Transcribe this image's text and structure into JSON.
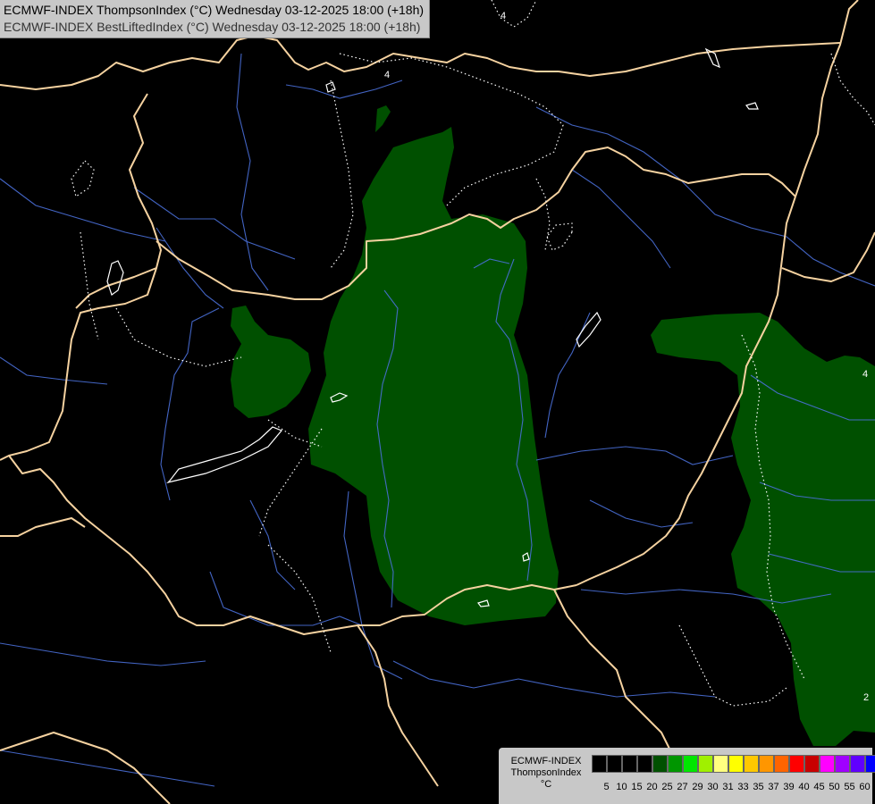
{
  "header": {
    "line1": "ECMWF-INDEX ThompsonIndex (°C) Wednesday 03-12-2025 18:00 (+18h)",
    "line2": "ECMWF-INDEX BestLiftedIndex (°C) Wednesday 03-12-2025 18:00 (+18h)"
  },
  "legend": {
    "source": "ECMWF-INDEX",
    "parameter": "ThompsonIndex",
    "unit": "°C",
    "values": [
      "5",
      "10",
      "15",
      "20",
      "25",
      "27",
      "29",
      "30",
      "31",
      "33",
      "35",
      "37",
      "39",
      "40",
      "45",
      "50",
      "55",
      "60"
    ],
    "colors": [
      "#000000",
      "#000000",
      "#000000",
      "#000000",
      "#005000",
      "#009600",
      "#00e600",
      "#a0f000",
      "#ffff80",
      "#ffff00",
      "#ffc800",
      "#ff9600",
      "#ff6400",
      "#ff0000",
      "#c80000",
      "#ff00ff",
      "#a000ff",
      "#6000ff",
      "#0000ff"
    ]
  },
  "contour_labels": [
    "4",
    "4",
    "4",
    "2"
  ],
  "colors": {
    "background": "#000000",
    "thompson_fill": "#005000",
    "border": "#f5d2a0",
    "river": "#4a6fd8",
    "contour": "#ffffff"
  }
}
